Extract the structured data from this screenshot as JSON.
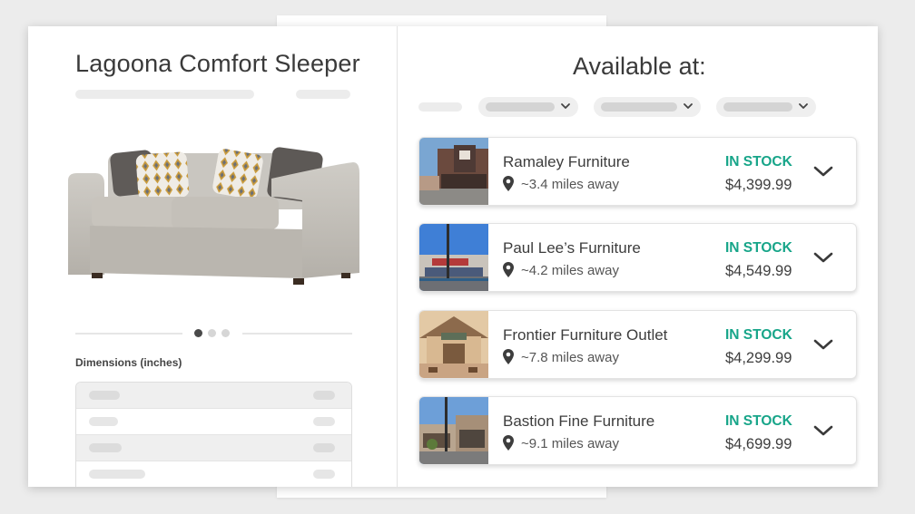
{
  "product": {
    "title": "Lagoona Comfort Sleeper",
    "dimensions_label": "Dimensions (inches)",
    "carousel": {
      "total": 3,
      "active": 1
    }
  },
  "availability": {
    "title": "Available at:",
    "stores": [
      {
        "name": "Ramaley Furniture",
        "distance": "~3.4 miles away",
        "stock": "IN STOCK",
        "price": "$4,399.99"
      },
      {
        "name": "Paul Lee’s Furniture",
        "distance": "~4.2 miles away",
        "stock": "IN STOCK",
        "price": "$4,549.99"
      },
      {
        "name": "Frontier Furniture Outlet",
        "distance": "~7.8 miles away",
        "stock": "IN STOCK",
        "price": "$4,299.99"
      },
      {
        "name": "Bastion Fine Furniture",
        "distance": "~9.1 miles away",
        "stock": "IN STOCK",
        "price": "$4,699.99"
      }
    ]
  },
  "colors": {
    "stock_green": "#17a589",
    "text_dark": "#3d3d3d",
    "skeleton": "#ececec"
  },
  "icons": {
    "location": "map-pin-icon",
    "expand": "chevron-down-icon"
  }
}
